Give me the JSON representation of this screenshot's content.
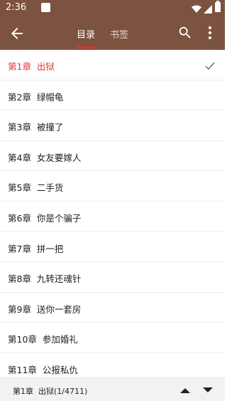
{
  "status_bar": {
    "time": "2:36"
  },
  "toolbar": {
    "tabs": [
      {
        "label": "目录",
        "active": true
      },
      {
        "label": "书签",
        "active": false
      }
    ]
  },
  "colors": {
    "header": "#7c5240",
    "current_chapter": "#d93a3a",
    "tab_indicator": "#e0322e"
  },
  "icons": [
    "back-arrow-icon",
    "search-icon",
    "more-vert-icon",
    "check-icon",
    "arrow-up-icon",
    "arrow-down-icon"
  ],
  "chapters": [
    {
      "label": "第1章  出狱",
      "current": true
    },
    {
      "label": "第2章  绿帽龟"
    },
    {
      "label": "第3章  被撞了"
    },
    {
      "label": "第4章  女友要嫁人"
    },
    {
      "label": "第5章  二手货"
    },
    {
      "label": "第6章  你是个骗子"
    },
    {
      "label": "第7章  拼一把"
    },
    {
      "label": "第8章  九转还魂针"
    },
    {
      "label": "第9章  送你一套房"
    },
    {
      "label": "第10章  参加婚礼"
    },
    {
      "label": "第11章  公报私仇"
    }
  ],
  "bottom_bar": {
    "position_label": "第1章  出狱(1/4711)"
  }
}
